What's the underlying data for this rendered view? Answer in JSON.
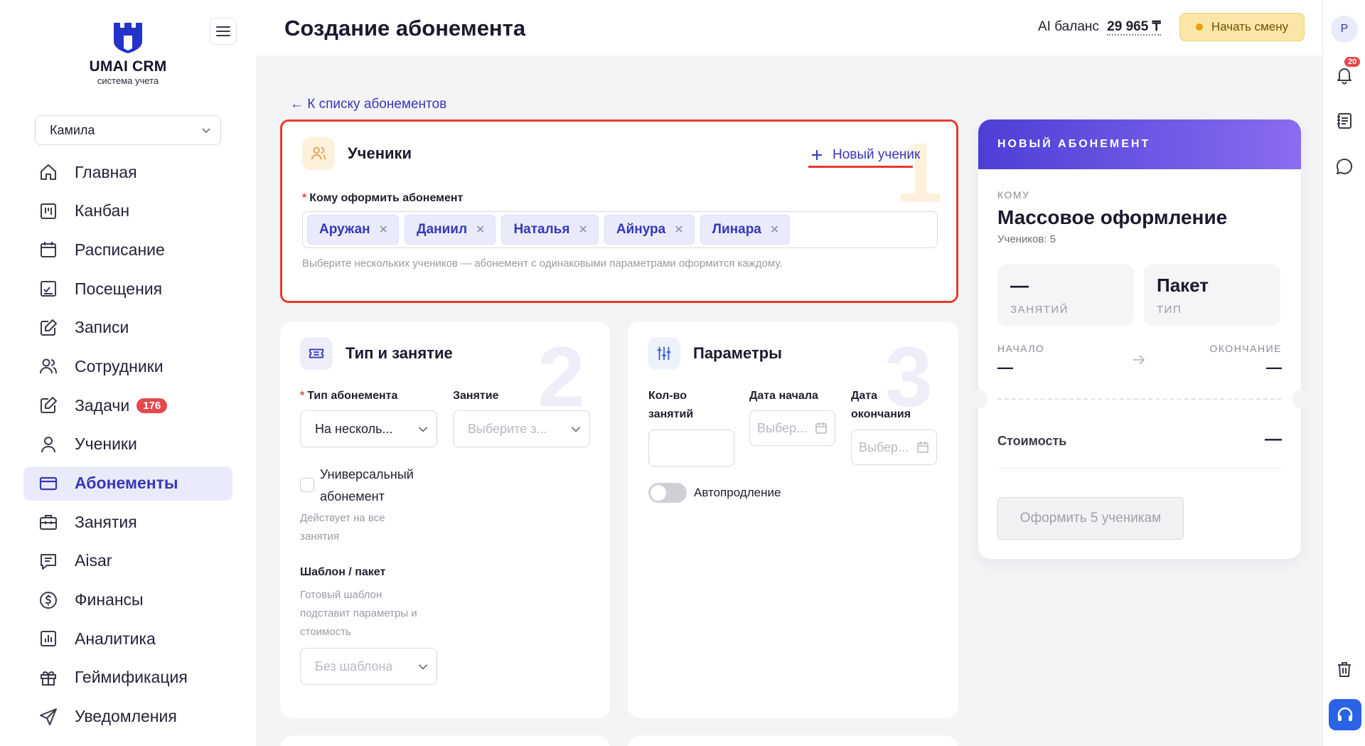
{
  "brand": {
    "name": "UMAI CRM",
    "subtitle": "система учета"
  },
  "sidebar": {
    "user": "Камила",
    "items": [
      {
        "label": "Главная",
        "icon": "home-icon"
      },
      {
        "label": "Канбан",
        "icon": "kanban-icon"
      },
      {
        "label": "Расписание",
        "icon": "calendar-icon"
      },
      {
        "label": "Посещения",
        "icon": "attendance-icon"
      },
      {
        "label": "Записи",
        "icon": "edit-icon"
      },
      {
        "label": "Сотрудники",
        "icon": "users-icon"
      },
      {
        "label": "Задачи",
        "icon": "tasks-icon",
        "badge": "176"
      },
      {
        "label": "Ученики",
        "icon": "user-icon"
      },
      {
        "label": "Абонементы",
        "icon": "card-icon",
        "active": true
      },
      {
        "label": "Занятия",
        "icon": "briefcase-icon"
      },
      {
        "label": "Aisar",
        "icon": "chat-icon"
      },
      {
        "label": "Финансы",
        "icon": "dollar-icon"
      },
      {
        "label": "Аналитика",
        "icon": "chart-icon"
      },
      {
        "label": "Геймификация",
        "icon": "gift-icon"
      },
      {
        "label": "Уведомления",
        "icon": "send-icon"
      }
    ]
  },
  "header": {
    "title": "Создание абонемента",
    "ai_label": "AI баланс",
    "ai_value": "29 965 ₸",
    "shift_button": "Начать смену"
  },
  "rail": {
    "avatar": "P",
    "notif_count": "20"
  },
  "back_link": "← К списку абонементов",
  "students": {
    "number": "1",
    "title": "Ученики",
    "new_student": "Новый ученик",
    "field_label": "Кому оформить абонемент",
    "tags": [
      "Аружан",
      "Даниил",
      "Наталья",
      "Айнура",
      "Линара"
    ],
    "hint": "Выберите нескольких учеников — абонемент с одинаковыми параметрами оформится каждому."
  },
  "type_card": {
    "number": "2",
    "title": "Тип и занятие",
    "type_label": "Тип абонемента",
    "type_value": "На несколь...",
    "lesson_label": "Занятие",
    "lesson_placeholder": "Выберите з...",
    "universal_line1": "Универсальный",
    "universal_line2": "абонемент",
    "universal_hint1": "Действует на все",
    "universal_hint2": "занятия",
    "template_label": "Шаблон / пакет",
    "template_hint1": "Готовый шаблон",
    "template_hint2": "подставит параметры и",
    "template_hint3": "стоимость",
    "template_value": "Без шаблона"
  },
  "params_card": {
    "number": "3",
    "title": "Параметры",
    "count_label1": "Кол-во",
    "count_label2": "занятий",
    "start_label": "Дата начала",
    "start_placeholder": "Выбер...",
    "end_label1": "Дата",
    "end_label2": "окончания",
    "end_placeholder": "Выбер...",
    "autorenew": "Автопродление"
  },
  "summary": {
    "header": "НОВЫЙ АБОНЕМЕНТ",
    "to_label": "КОМУ",
    "title": "Массовое оформление",
    "students_count": "Учеников: 5",
    "lessons_value": "—",
    "lessons_label": "ЗАНЯТИЙ",
    "type_value": "Пакет",
    "type_label": "ТИП",
    "start_label": "НАЧАЛО",
    "start_value": "—",
    "end_label": "ОКОНЧАНИЕ",
    "end_value": "—",
    "cost_label": "Стоимость",
    "cost_value": "—",
    "submit": "Оформить 5 ученикам"
  }
}
